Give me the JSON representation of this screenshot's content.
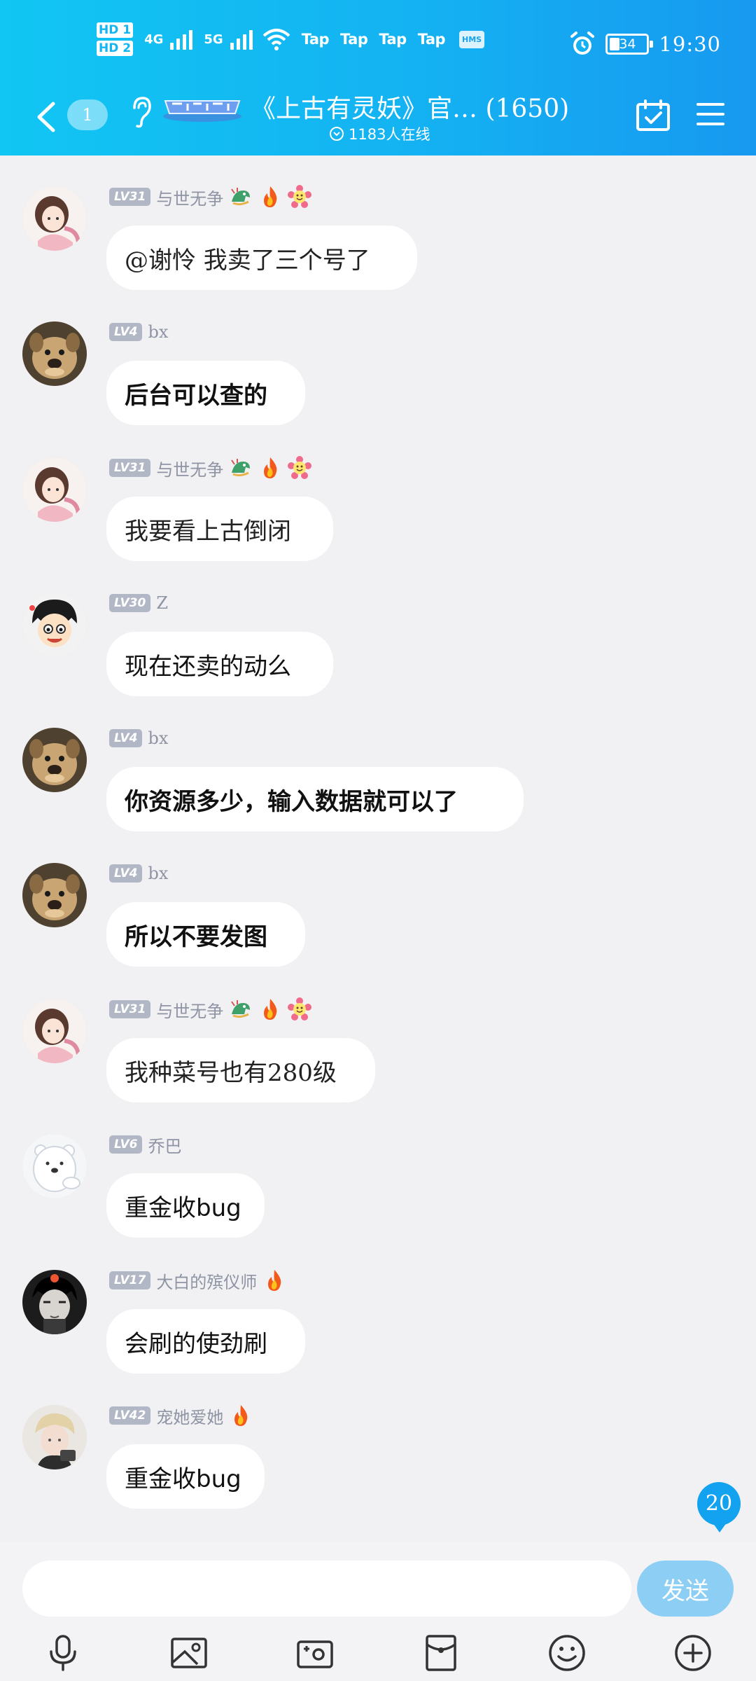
{
  "status_bar": {
    "sim1": "HD 1",
    "sim2": "HD 2",
    "net1": "4G",
    "net2": "5G",
    "tap_labels": [
      "Tap",
      "Tap",
      "Tap",
      "Tap"
    ],
    "hms": "HMS",
    "battery": "34",
    "time": "19:30"
  },
  "header": {
    "unread_count": "1",
    "group_title": "《上古有灵妖》官… (1650)",
    "online_text": "1183人在线"
  },
  "messages": [
    {
      "level": "LV31",
      "name": "与世无争",
      "text": "@谢怜 我卖了三个号了",
      "avatar": "anime-girl",
      "style": "thin",
      "badges": [
        "dragon",
        "fire",
        "flower"
      ]
    },
    {
      "level": "LV4",
      "name": "bx",
      "text": "后台可以查的",
      "avatar": "dog",
      "style": "bold",
      "badges": []
    },
    {
      "level": "LV31",
      "name": "与世无争",
      "text": "我要看上古倒闭",
      "avatar": "anime-girl",
      "style": "thin",
      "badges": [
        "dragon",
        "fire",
        "flower"
      ]
    },
    {
      "level": "LV30",
      "name": "Z",
      "text": "现在还卖的动么",
      "avatar": "cartoon-boy",
      "style": "normal",
      "badges": []
    },
    {
      "level": "LV4",
      "name": "bx",
      "text": "你资源多少，输入数据就可以了",
      "avatar": "dog",
      "style": "bold",
      "badges": []
    },
    {
      "level": "LV4",
      "name": "bx",
      "text": "所以不要发图",
      "avatar": "dog",
      "style": "bold",
      "badges": []
    },
    {
      "level": "LV31",
      "name": "与世无争",
      "text": "我种菜号也有280级",
      "avatar": "anime-girl",
      "style": "thin",
      "badges": [
        "dragon",
        "fire",
        "flower"
      ]
    },
    {
      "level": "LV6",
      "name": "乔巴",
      "text": "重金收bug",
      "avatar": "polar-bear",
      "style": "normal",
      "badges": []
    },
    {
      "level": "LV17",
      "name": "大白的殡仪师",
      "text": "会刷的使劲刷",
      "avatar": "dark-boy",
      "style": "normal",
      "badges": [
        "fire"
      ]
    },
    {
      "level": "LV42",
      "name": "宠她爱她",
      "text": "重金收bug",
      "avatar": "blond-boy",
      "style": "normal",
      "badges": [
        "fire"
      ]
    }
  ],
  "new_message_count": "20",
  "input": {
    "placeholder": "",
    "send_label": "发送"
  },
  "toolbar": [
    "mic-icon",
    "image-icon",
    "camera-icon",
    "red-packet-icon",
    "emoji-icon",
    "plus-icon"
  ],
  "colors": {
    "header_start": "#11c6f3",
    "header_end": "#1799f0",
    "level_badge": "#b2b7c6",
    "send_button": "#8ccef4",
    "counter_badge": "#12a2f0"
  }
}
